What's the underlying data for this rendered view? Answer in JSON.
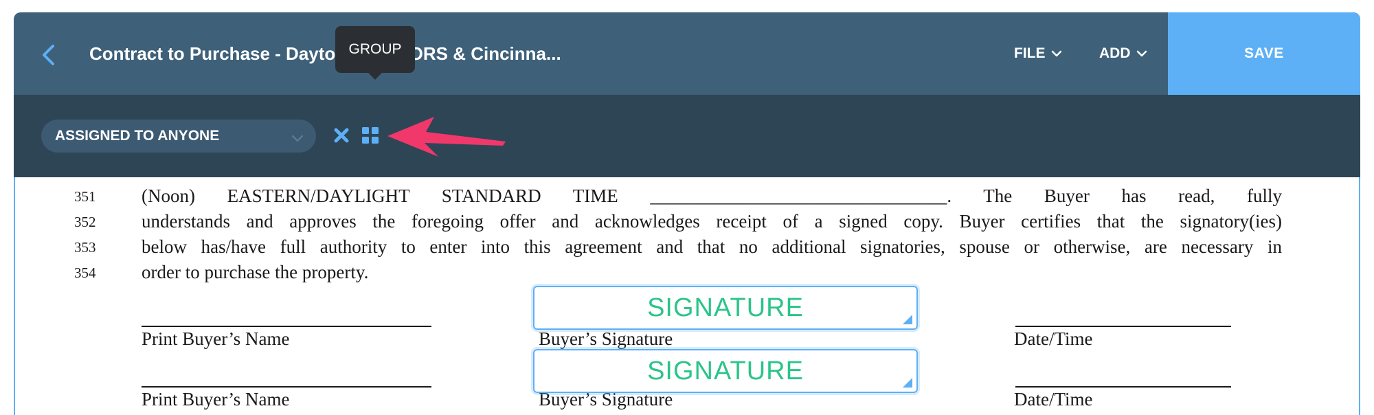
{
  "header": {
    "title": "Contract to Purchase - Dayton REALTORS & Cincinna...",
    "file_label": "FILE",
    "add_label": "ADD",
    "save_label": "SAVE"
  },
  "toolbar": {
    "assignee_value": "ASSIGNED TO ANYONE",
    "tooltip": "GROUP"
  },
  "document": {
    "lines": [
      {
        "num": "351",
        "text": "(Noon) EASTERN/DAYLIGHT STANDARD TIME ________________________________. The Buyer has read, fully"
      },
      {
        "num": "352",
        "text": "understands and approves the foregoing offer and acknowledges receipt of a signed copy. Buyer certifies that the signatory(ies)"
      },
      {
        "num": "353",
        "text": "below has/have full authority to enter into this agreement and that no additional signatories, spouse or otherwise, are necessary in"
      },
      {
        "num": "354",
        "text": "order to purchase the property."
      }
    ],
    "signature_rows": [
      {
        "name_label": "Print Buyer’s Name",
        "sig_label": "Buyer’s Signature",
        "date_label": "Date/Time",
        "field_text": "SIGNATURE"
      },
      {
        "name_label": "Print Buyer’s Name",
        "sig_label": "Buyer’s Signature",
        "date_label": "Date/Time",
        "field_text": "SIGNATURE"
      }
    ]
  },
  "colors": {
    "header_bg": "#3e6079",
    "toolbar_bg": "#2e4556",
    "save_bg": "#5db0f5",
    "accent_blue": "#5db0f5",
    "signature_text": "#2bc48a",
    "annotation_arrow": "#f0386b"
  },
  "icons": {
    "back": "chevron-left-icon",
    "file_chevron": "chevron-down-icon",
    "add_chevron": "chevron-down-icon",
    "select_chevron": "chevron-down-icon",
    "clear": "close-icon",
    "group": "grid-icon",
    "annotation": "arrow-left-icon"
  }
}
